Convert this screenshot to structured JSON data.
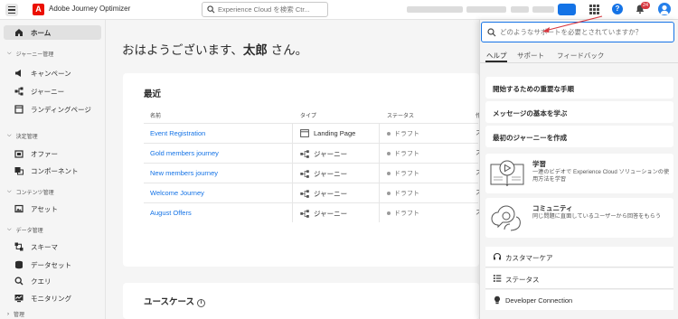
{
  "app": {
    "title": "Adobe Journey Optimizer",
    "logo_letter": "A"
  },
  "topbar": {
    "search_placeholder": "Experience Cloud を検索 Ctr...",
    "bell_badge": "24",
    "help_glyph": "?"
  },
  "sidebar": {
    "home": "ホーム",
    "sections": [
      {
        "label": "ジャーニー管理",
        "items": [
          "キャンペーン",
          "ジャーニー",
          "ランディングページ"
        ]
      },
      {
        "label": "決定管理",
        "items": [
          "オファー",
          "コンポーネント"
        ]
      },
      {
        "label": "コンテンツ管理",
        "items": [
          "アセット"
        ]
      },
      {
        "label": "データ管理",
        "items": [
          "スキーマ",
          "データセット",
          "クエリ",
          "モニタリング"
        ]
      },
      {
        "label": "管理"
      }
    ]
  },
  "main": {
    "greeting_prefix": "おはようございます、",
    "greeting_name": "太郎",
    "greeting_suffix": " さん。",
    "recent": {
      "title": "最近",
      "columns": [
        "名前",
        "タイプ",
        "ステータス",
        "作"
      ],
      "rows": [
        {
          "name": "Event Registration",
          "type": "Landing Page",
          "type_icon": "landing-page-icon",
          "status": "ドラフト",
          "extra": "ス"
        },
        {
          "name": "Gold members journey",
          "type": "ジャーニー",
          "type_icon": "journey-icon",
          "status": "ドラフト",
          "extra": "ス"
        },
        {
          "name": "New members journey",
          "type": "ジャーニー",
          "type_icon": "journey-icon",
          "status": "ドラフト",
          "extra": "ス"
        },
        {
          "name": "Welcome Journey",
          "type": "ジャーニー",
          "type_icon": "journey-icon",
          "status": "ドラフト",
          "extra": "ス"
        },
        {
          "name": "August Offers",
          "type": "ジャーニー",
          "type_icon": "journey-icon",
          "status": "ドラフト",
          "extra": "ス"
        }
      ]
    },
    "usecases": {
      "title": "ユースケース",
      "info_glyph": "i"
    }
  },
  "help_panel": {
    "search_placeholder": "どのようなサポートを必要とされていますか？",
    "tabs": [
      "ヘルプ",
      "サポート",
      "フィードバック"
    ],
    "links": [
      "開始するための重要な手順",
      "メッセージの基本を学ぶ",
      "最初のジャーニーを作成"
    ],
    "resources": [
      {
        "title": "学習",
        "description": "一連のビデオで Experience Cloud ソリューションの使用方法を学習",
        "icon": "learning-video-icon"
      },
      {
        "title": "コミュニティ",
        "description": "同じ問題に直面しているユーザーから回答をもらう",
        "icon": "community-icon"
      }
    ],
    "support_items": [
      {
        "label": "カスタマーケア",
        "icon": "headset-icon"
      },
      {
        "label": "ステータス",
        "icon": "status-list-icon"
      },
      {
        "label": "Developer Connection",
        "icon": "lightbulb-icon"
      }
    ]
  },
  "colors": {
    "accent": "#1473e6",
    "adobe_red": "#eb1000",
    "annotation_arrow": "#d7373f"
  }
}
